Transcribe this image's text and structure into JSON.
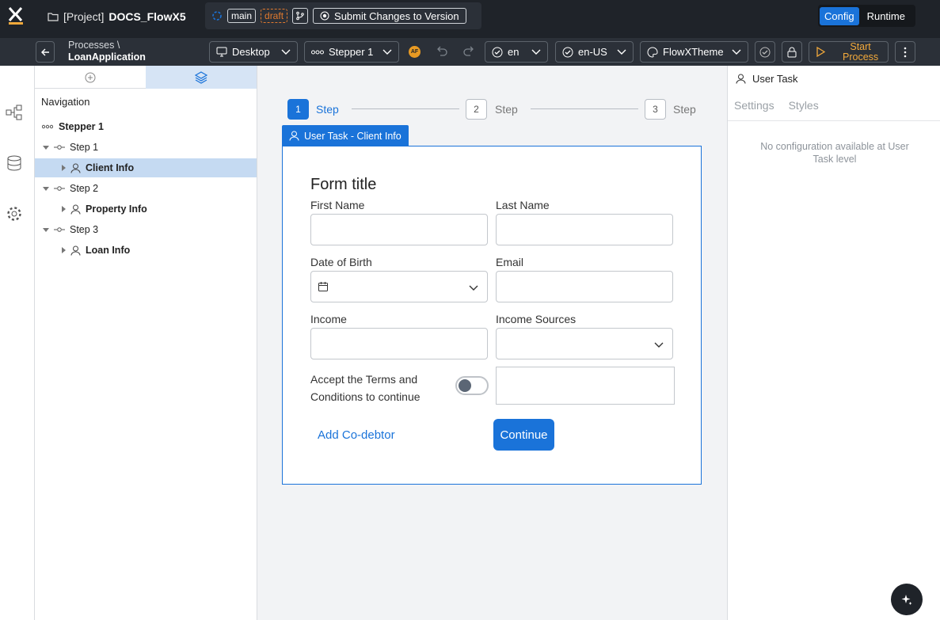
{
  "header": {
    "project_prefix": "[Project]",
    "project_name": "DOCS_FlowX5",
    "branch": "main",
    "status": "draft",
    "submit_label": "Submit Changes to Version",
    "modes": [
      "Config",
      "Runtime"
    ],
    "active_mode": "Config"
  },
  "toolbar": {
    "breadcrumb_parent": "Processes \\",
    "breadcrumb_current": "LoanApplication",
    "device": "Desktop",
    "stepper": "Stepper 1",
    "af_badge": "AF",
    "language": "en",
    "locale": "en-US",
    "theme": "FlowXTheme",
    "start_line1": "Start",
    "start_line2": "Process"
  },
  "navigation": {
    "title": "Navigation",
    "root": "Stepper 1",
    "items": [
      {
        "label": "Step 1",
        "type": "step"
      },
      {
        "label": "Client Info",
        "type": "task"
      },
      {
        "label": "Step 2",
        "type": "step"
      },
      {
        "label": "Property Info",
        "type": "task"
      },
      {
        "label": "Step 3",
        "type": "step"
      },
      {
        "label": "Loan Info",
        "type": "task"
      }
    ],
    "selected": "Client Info"
  },
  "stepper": {
    "steps": [
      {
        "number": "1",
        "label": "Step"
      },
      {
        "number": "2",
        "label": "Step"
      },
      {
        "number": "3",
        "label": "Step"
      }
    ]
  },
  "card": {
    "tag": "User Task - Client Info",
    "form_title": "Form title",
    "fields": {
      "first_name": "First Name",
      "last_name": "Last Name",
      "dob": "Date of Birth",
      "email": "Email",
      "income": "Income",
      "income_sources": "Income Sources",
      "terms_line1": "Accept the Terms and",
      "terms_line2": "Conditions to continue"
    },
    "add_codebtor": "Add Co-debtor",
    "continue": "Continue"
  },
  "right_panel": {
    "title": "User Task",
    "tabs": [
      "Settings",
      "Styles"
    ],
    "message": "No configuration available at User Task level"
  },
  "colors": {
    "accent": "#1a73d9",
    "topbar": "#1f2329",
    "toolbar": "#2b3038",
    "draft": "#e07a2e",
    "start": "#f2a93b"
  }
}
